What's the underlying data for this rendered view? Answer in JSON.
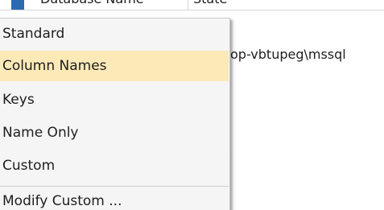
{
  "grid": {
    "columns": [
      "Database Name",
      "State"
    ]
  },
  "background": {
    "path_text": "op-vbtupeg\\mssql"
  },
  "menu": {
    "items": [
      {
        "label": "Standard",
        "selected": false
      },
      {
        "label": "Column Names",
        "selected": true
      },
      {
        "label": "Keys",
        "selected": false
      },
      {
        "label": "Name Only",
        "selected": false
      },
      {
        "label": "Custom",
        "selected": false
      },
      {
        "label": "Modify Custom ...",
        "selected": false
      }
    ]
  },
  "colors": {
    "selected_highlight": "#fbe9b8",
    "menu_background": "#f5f5f5",
    "row_indicator": "#2b6cb0"
  }
}
